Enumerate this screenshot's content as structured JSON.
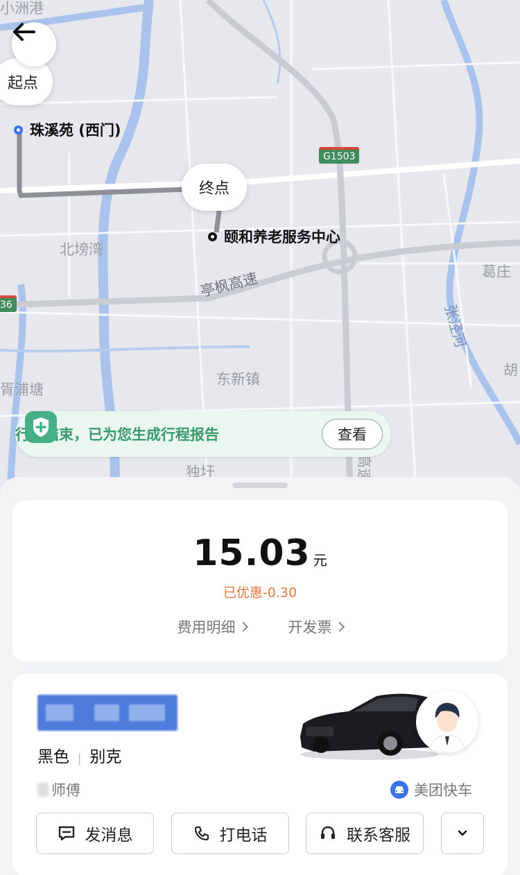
{
  "map": {
    "labels": {
      "top_left": "小洲港",
      "beibang": "北塝湾",
      "gezhuang": "葛庄",
      "zhangjing": "张泾河",
      "hu": "胡",
      "xupu": "胥浦塘",
      "dongxin": "东新镇",
      "duyu": "独圩",
      "gaosu": "高速",
      "highway": "亭枫高速",
      "road_code": "G1503",
      "road_code_left": "36"
    },
    "start_pill": "起点",
    "end_pill": "终点",
    "start_poi": "珠溪苑 (西门)",
    "end_poi": "颐和养老服务中心"
  },
  "banner": {
    "text": "行程结束，已为您生成行程报告",
    "button": "查看",
    "color": "#3a9a6e"
  },
  "fare": {
    "amount": "15.03",
    "unit": "元",
    "discount": "已优惠-0.30",
    "detail_link": "费用明细",
    "invoice_link": "开发票"
  },
  "driver": {
    "car_color": "黑色",
    "car_brand": "别克",
    "name_suffix": "师傅",
    "service": "美团快车"
  },
  "actions": {
    "message": "发消息",
    "call": "打电话",
    "support": "联系客服"
  },
  "icons": [
    "back-arrow-icon",
    "shield-plus-icon",
    "message-icon",
    "phone-icon",
    "headset-icon",
    "chevron-down-icon",
    "car-icon"
  ]
}
